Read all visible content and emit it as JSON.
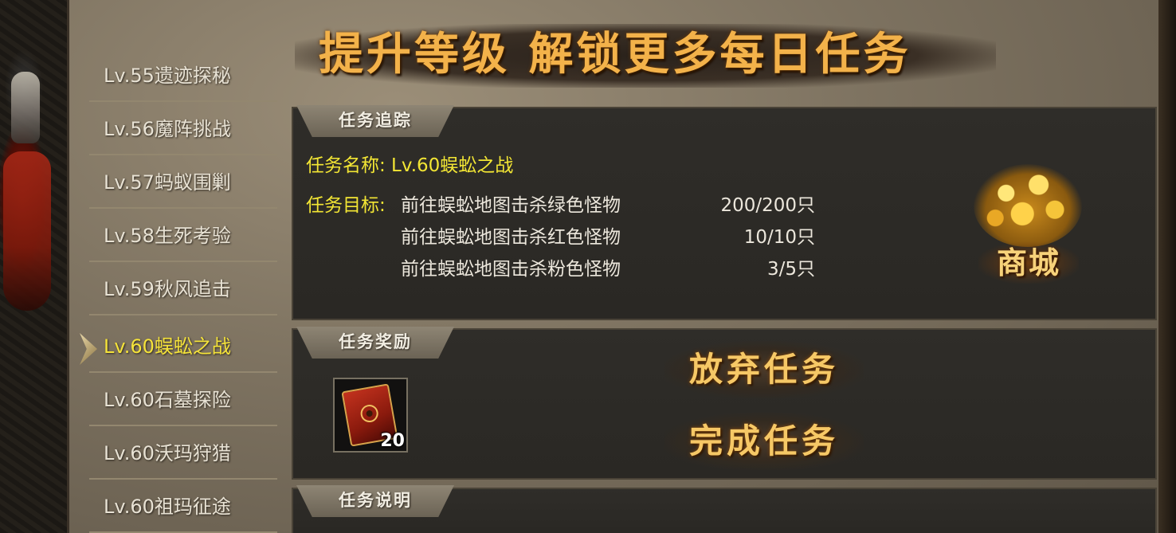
{
  "header": {
    "title": "提升等级 解锁更多每日任务"
  },
  "sidebar": {
    "items": [
      {
        "label": "Lv.55遗迹探秘",
        "active": false
      },
      {
        "label": "Lv.56魔阵挑战",
        "active": false
      },
      {
        "label": "Lv.57蚂蚁围剿",
        "active": false
      },
      {
        "label": "Lv.58生死考验",
        "active": false
      },
      {
        "label": "Lv.59秋风追击",
        "active": false
      },
      {
        "label": "Lv.60蜈蚣之战",
        "active": true
      },
      {
        "label": "Lv.60石墓探险",
        "active": false
      },
      {
        "label": "Lv.60沃玛狩猎",
        "active": false
      },
      {
        "label": "Lv.60祖玛征途",
        "active": false
      }
    ]
  },
  "tracking": {
    "tab_label": "任务追踪",
    "task_name": "任务名称: Lv.60蜈蚣之战",
    "goal_label": "任务目标:",
    "goals": [
      {
        "text": "前往蜈蚣地图击杀绿色怪物",
        "count": "200/200只"
      },
      {
        "text": "前往蜈蚣地图击杀红色怪物",
        "count": "10/10只"
      },
      {
        "text": "前往蜈蚣地图击杀粉色怪物",
        "count": "3/5只"
      }
    ]
  },
  "shop": {
    "label": "商城"
  },
  "reward": {
    "tab_label": "任务奖励",
    "item_count": "20"
  },
  "actions": {
    "abandon_label": "放弃任务",
    "complete_label": "完成任务"
  },
  "description": {
    "tab_label": "任务说明"
  },
  "colors": {
    "accent_gold": "#f3b24a",
    "active_yellow": "#f3e634",
    "panel_dark": "#2f2d29"
  }
}
